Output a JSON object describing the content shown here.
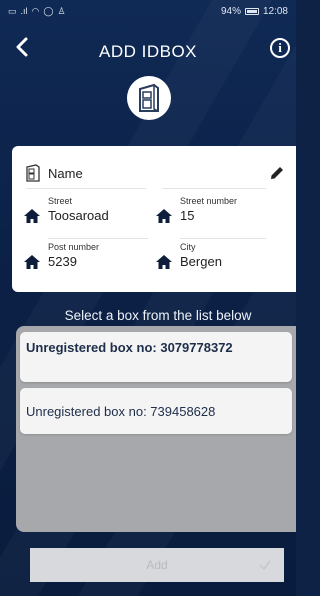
{
  "status_bar": {
    "left_icons": [
      "sim-icon",
      "signal-icon",
      "wifi-icon",
      "location-icon",
      "person-icon"
    ],
    "battery": "94%",
    "time": "12:08"
  },
  "header": {
    "title": "ADD IDBOX",
    "back_icon": "chevron-left-icon",
    "info_icon": "info-icon"
  },
  "address": {
    "name": "Name",
    "street_label": "Street",
    "street_value": "Toosaroad",
    "street_number_label": "Street number",
    "street_number_value": "15",
    "post_number_label": "Post number",
    "post_number_value": "5239",
    "city_label": "City",
    "city_value": "Bergen"
  },
  "box_list": {
    "title": "Select a box from the list below",
    "items": [
      {
        "label": "Unregistered box no: 3079778372",
        "selected": true
      },
      {
        "label": "Unregistered box no: 739458628",
        "selected": false
      }
    ]
  },
  "footer": {
    "add_label": "Add"
  },
  "colors": {
    "background": "#0c2148",
    "card": "#ffffff",
    "list_panel": "#a6a8ab",
    "list_item": "#f4f4f4",
    "item_text": "#1e2e4a",
    "add_button": "#d7d9dc"
  }
}
